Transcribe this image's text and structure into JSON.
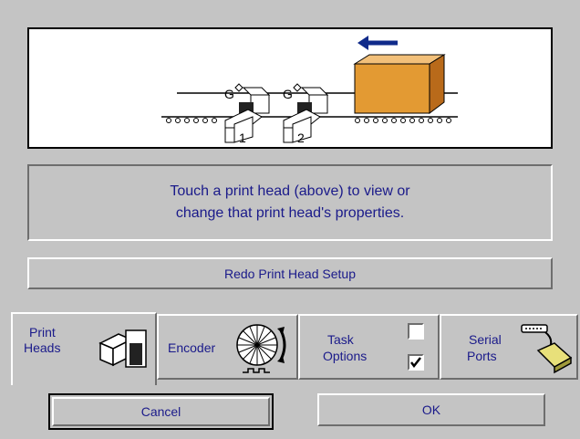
{
  "diagram": {
    "head_labels": [
      "1",
      "2"
    ],
    "encoder_labels": [
      "G",
      "G"
    ],
    "colors": {
      "box": "#e39a33",
      "arrow": "#0f2a8a",
      "line": "#000000"
    }
  },
  "info": {
    "line1": "Touch a print head (above) to view or",
    "line2": "change that print head's properties."
  },
  "redo_button": {
    "label": "Redo Print Head Setup"
  },
  "tabs": {
    "print_heads": {
      "line1": "Print",
      "line2": "Heads",
      "icon": "print-head-icon"
    },
    "encoder": {
      "label": "Encoder",
      "icon": "encoder-wheel-icon"
    },
    "task_options": {
      "line1": "Task",
      "line2": "Options",
      "checkbox_top": false,
      "checkbox_bottom": true
    },
    "serial_ports": {
      "line1": "Serial",
      "line2": "Ports",
      "icon": "serial-cable-icon"
    }
  },
  "buttons": {
    "cancel": "Cancel",
    "ok": "OK"
  },
  "colors": {
    "background": "#c4c4c4",
    "text": "#1a1a8a"
  }
}
